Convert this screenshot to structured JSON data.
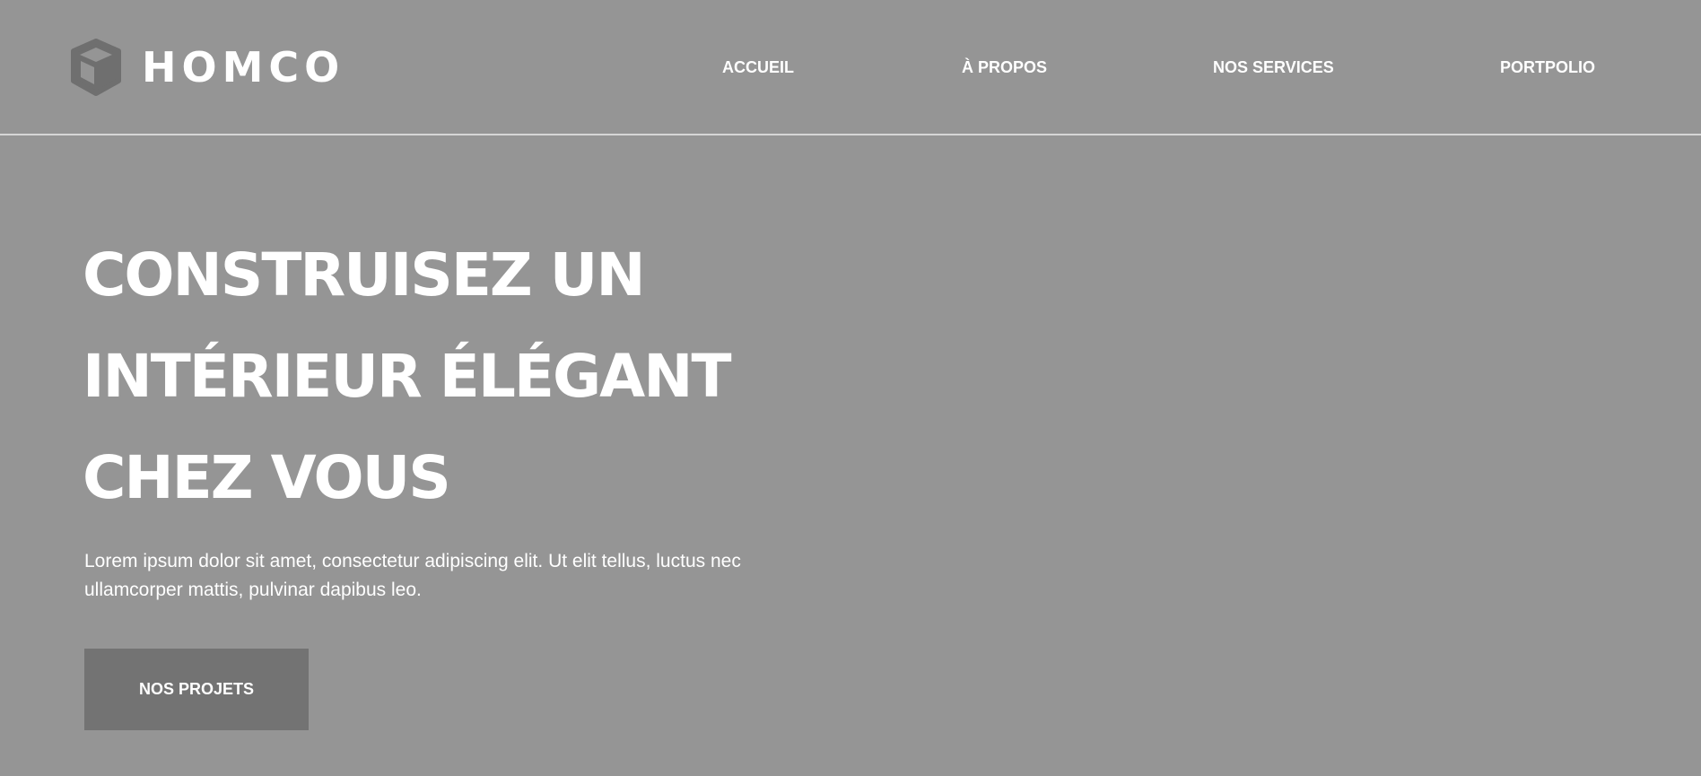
{
  "brand": {
    "name": "HOMCO",
    "icon": "cube-logo-icon"
  },
  "nav": {
    "items": [
      {
        "label": "ACCUEIL"
      },
      {
        "label": "À PROPOS"
      },
      {
        "label": "NOS SERVICES"
      },
      {
        "label": "PORTPOLIO"
      }
    ]
  },
  "hero": {
    "title_lines": [
      "CONSTRUISEZ UN",
      "INTÉRIEUR ÉLÉGANT",
      "CHEZ VOUS"
    ],
    "text": "Lorem ipsum dolor sit amet, consectetur adipiscing elit. Ut elit tellus, luctus nec ullamcorper mattis, pulvinar dapibus leo.",
    "button_label": "NOS PROJETS"
  },
  "colors": {
    "background": "#959595",
    "button": "#737373",
    "logo_icon": "#6f6f6f",
    "text": "#ffffff"
  }
}
